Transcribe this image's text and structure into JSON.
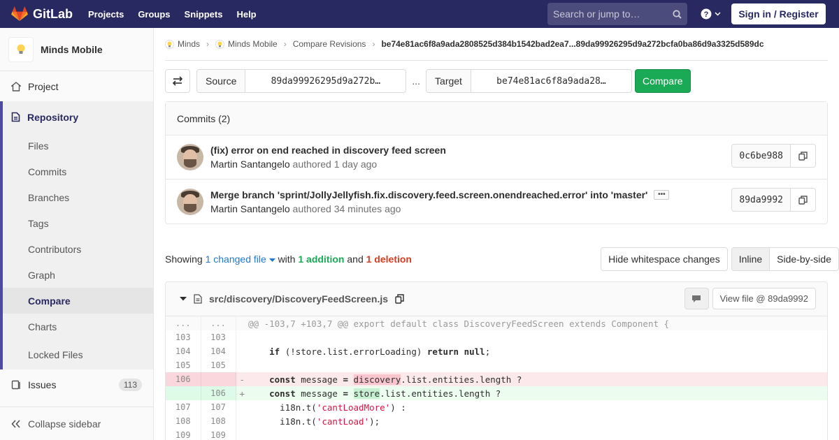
{
  "topbar": {
    "brand": "GitLab",
    "nav": [
      "Projects",
      "Groups",
      "Snippets",
      "Help"
    ],
    "search_placeholder": "Search or jump to…",
    "signin": "Sign in / Register"
  },
  "sidebar": {
    "project_name": "Minds Mobile",
    "project": "Project",
    "repository": "Repository",
    "repo_items": [
      "Files",
      "Commits",
      "Branches",
      "Tags",
      "Contributors",
      "Graph",
      "Compare",
      "Charts",
      "Locked Files"
    ],
    "active_item": "Compare",
    "issues": "Issues",
    "issues_count": "113",
    "collapse": "Collapse sidebar"
  },
  "breadcrumb": {
    "items": [
      "Minds",
      "Minds Mobile",
      "Compare Revisions"
    ],
    "current": "be74e81ac6f8a9ada2808525d384b1542bad2ea7...89da99926295d9a272bcfa0ba86d9a3325d589dc"
  },
  "compare": {
    "source_label": "Source",
    "source_value": "89da99926295d9a272b…",
    "separator": "...",
    "target_label": "Target",
    "target_value": "be74e81ac6f8a9ada28…",
    "compare_label": "Compare"
  },
  "commits": {
    "header": "Commits (2)",
    "list": [
      {
        "title": "(fix) error on end reached in discovery feed screen",
        "author": "Martin Santangelo",
        "verb": "authored",
        "time": "1 day ago",
        "sha": "0c6be988"
      },
      {
        "title": "Merge branch 'sprint/JollyJellyfish.fix.discovery.feed.screen.onendreached.error' into 'master'",
        "author": "Martin Santangelo",
        "verb": "authored",
        "time": "34 minutes ago",
        "sha": "89da9992"
      }
    ]
  },
  "summary": {
    "showing": "Showing",
    "changed": "1 changed file",
    "with": "with",
    "additions": "1 addition",
    "and": "and",
    "deletions": "1 deletion",
    "hide_ws": "Hide whitespace changes",
    "inline": "Inline",
    "side_by_side": "Side-by-side"
  },
  "file": {
    "path": "src/discovery/DiscoveryFeedScreen.js",
    "view_file": "View file @ 89da9992",
    "hunk_header": "@@ -103,7 +103,7 @@ export default class DiscoveryFeedScreen extends Component {"
  }
}
